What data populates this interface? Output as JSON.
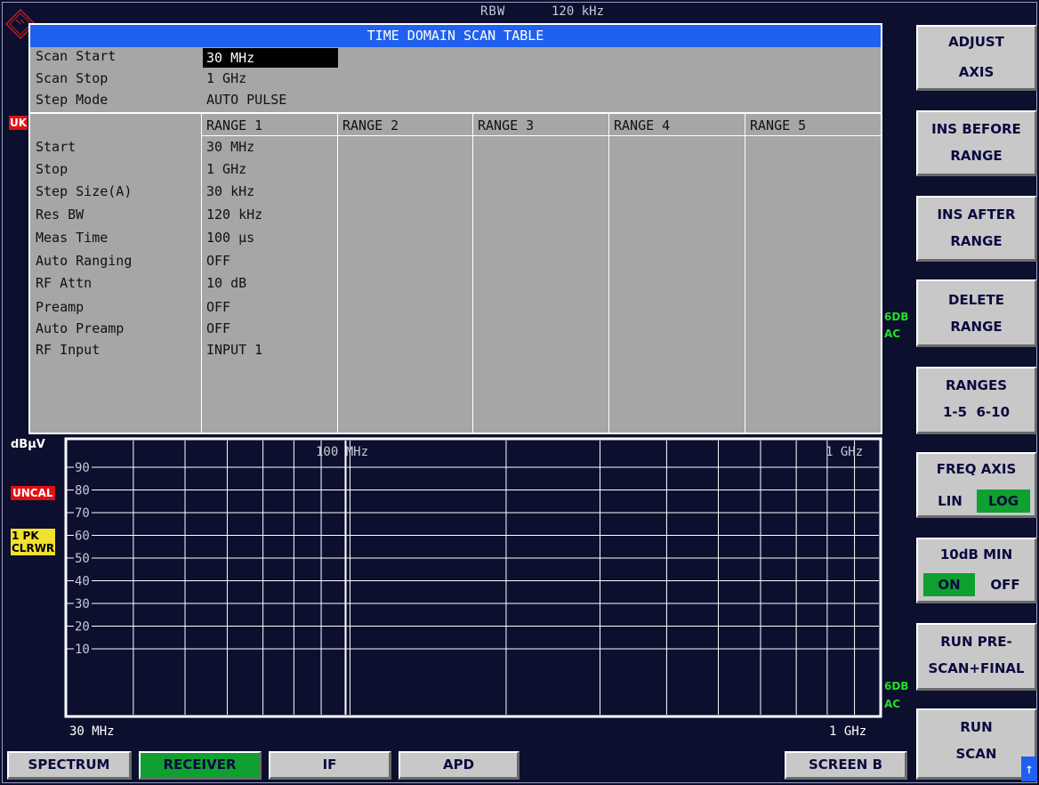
{
  "header": {
    "rbw_label": "RBW",
    "rbw_value": "120 kHz",
    "uk_badge": "UK"
  },
  "table": {
    "title": "TIME DOMAIN SCAN TABLE",
    "scan_start_label": "Scan Start",
    "scan_start_value": "30 MHz",
    "scan_stop_label": "Scan Stop",
    "scan_stop_value": "1 GHz",
    "step_mode_label": "Step Mode",
    "step_mode_value": "AUTO PULSE",
    "range_headers": [
      "RANGE 1",
      "RANGE 2",
      "RANGE 3",
      "RANGE 4",
      "RANGE 5"
    ],
    "rows": [
      {
        "label": "Start",
        "value": "30 MHz"
      },
      {
        "label": "Stop",
        "value": "1 GHz"
      },
      {
        "label": "Step Size(A)",
        "value": "30 kHz"
      },
      {
        "label": "Res BW",
        "value": "120 kHz"
      },
      {
        "label": "Meas Time",
        "value": "100 µs"
      },
      {
        "label": "Auto Ranging",
        "value": "OFF"
      },
      {
        "label": "RF Attn",
        "value": "10 dB"
      },
      {
        "label": "Preamp",
        "value": "OFF"
      },
      {
        "label": "Auto Preamp",
        "value": "OFF"
      },
      {
        "label": "RF Input",
        "value": "INPUT 1"
      }
    ]
  },
  "graph": {
    "unit": "dBµV",
    "uncal": "UNCAL",
    "trace_badge_1": "1 PK",
    "trace_badge_2": "CLRWR",
    "y_ticks": [
      "90",
      "80",
      "70",
      "60",
      "50",
      "40",
      "30",
      "20",
      "10"
    ],
    "x_marker_100mhz": "100 MHz",
    "x_marker_1ghz": "1 GHz",
    "x_start": "30 MHz",
    "x_stop": "1 GHz",
    "side_label_top_1": "6DB",
    "side_label_top_2": "AC",
    "side_label_bottom_1": "6DB",
    "side_label_bottom_2": "AC",
    "x_scale": "log"
  },
  "softkeys": {
    "adjust_axis": [
      "ADJUST",
      "AXIS"
    ],
    "ins_before_range": [
      "INS BEFORE",
      "RANGE"
    ],
    "ins_after_range": [
      "INS AFTER",
      "RANGE"
    ],
    "delete_range": [
      "DELETE",
      "RANGE"
    ],
    "ranges": [
      "RANGES",
      "1-5  6-10"
    ],
    "freq_axis": {
      "title": "FREQ AXIS",
      "lin": "LIN",
      "log": "LOG",
      "selected": "LOG"
    },
    "min_10db": {
      "title": "10dB MIN",
      "on": "ON",
      "off": "OFF",
      "selected": "ON"
    },
    "run_prescan": [
      "RUN PRE-",
      "SCAN+FINAL"
    ],
    "run_scan": [
      "RUN",
      "SCAN"
    ]
  },
  "hotkeys": {
    "spectrum": "SPECTRUM",
    "receiver": "RECEIVER",
    "if": "IF",
    "apd": "APD",
    "screen_b": "SCREEN B",
    "arrow": "↑"
  },
  "colors": {
    "background": "#0c0f2e",
    "table_bg": "#a6a6a6",
    "title_bar": "#2060f0",
    "active_green": "#10a030",
    "uncal_red": "#e01010",
    "trace_yellow": "#f0e030"
  }
}
